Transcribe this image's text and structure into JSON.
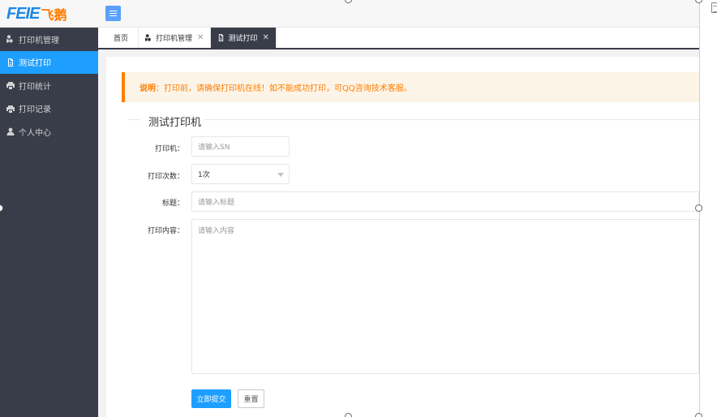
{
  "header": {
    "logo_latin": "FEIE",
    "logo_cn": "飞鹅"
  },
  "sidebar": {
    "items": [
      {
        "label": "打印机管理",
        "icon": "printer-group-icon",
        "active": false
      },
      {
        "label": "测试打印",
        "icon": "document-icon",
        "active": true
      },
      {
        "label": "打印统计",
        "icon": "printer-icon",
        "active": false
      },
      {
        "label": "打印记录",
        "icon": "printer-icon",
        "active": false
      },
      {
        "label": "个人中心",
        "icon": "user-icon",
        "active": false
      }
    ]
  },
  "tabs": [
    {
      "label": "首页",
      "closable": false,
      "active": false
    },
    {
      "label": "打印机管理",
      "icon": "printer-group-icon",
      "closable": true,
      "active": false
    },
    {
      "label": "测试打印",
      "icon": "document-icon",
      "closable": true,
      "active": true
    }
  ],
  "notice": {
    "label": "说明",
    "text": "：打印前，请确保打印机在线！如不能成功打印，可QQ咨询技术客服。"
  },
  "form": {
    "legend": "测试打印机",
    "printer": {
      "label": "打印机：",
      "placeholder": "请输入SN"
    },
    "times": {
      "label": "打印次数：",
      "value": "1次"
    },
    "title": {
      "label": "标题：",
      "placeholder": "请输入标题"
    },
    "content": {
      "label": "打印内容：",
      "placeholder": "请输入内容"
    },
    "submit_label": "立即提交",
    "reset_label": "重置"
  },
  "colors": {
    "accent": "#1e9fff",
    "sidebar_bg": "#393d49",
    "notice_orange": "#ff7e00",
    "logo_blue": "#1e88e5",
    "logo_orange": "#ff7a00"
  }
}
